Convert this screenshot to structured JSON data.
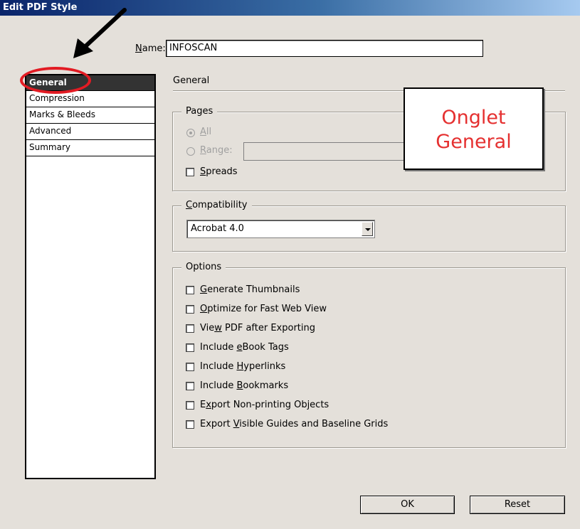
{
  "window": {
    "title": "Edit PDF Style"
  },
  "name_field": {
    "label_prefix": "",
    "label_accel": "N",
    "label_rest": "ame:",
    "value": "INFOSCAN"
  },
  "sidebar": {
    "items": [
      {
        "label": "General",
        "selected": true
      },
      {
        "label": "Compression",
        "selected": false
      },
      {
        "label": "Marks & Bleeds",
        "selected": false
      },
      {
        "label": "Advanced",
        "selected": false
      },
      {
        "label": "Summary",
        "selected": false
      }
    ]
  },
  "panel": {
    "heading": "General"
  },
  "pages": {
    "legend": "Pages",
    "all": {
      "accel": "A",
      "rest": "ll",
      "selected": true,
      "disabled": true
    },
    "range": {
      "accel": "R",
      "rest": "ange:",
      "disabled": true,
      "value": ""
    },
    "spreads": {
      "accel": "S",
      "rest": "preads",
      "checked": false
    }
  },
  "compatibility": {
    "legend_accel": "C",
    "legend_rest": "ompatibility",
    "selected": "Acrobat 4.0"
  },
  "options": {
    "legend": "Options",
    "items": [
      {
        "pre": "",
        "accel": "G",
        "post": "enerate Thumbnails",
        "checked": false
      },
      {
        "pre": "",
        "accel": "O",
        "post": "ptimize for Fast Web View",
        "checked": false
      },
      {
        "pre": "Vie",
        "accel": "w",
        "post": " PDF after Exporting",
        "checked": false
      },
      {
        "pre": "Include ",
        "accel": "e",
        "post": "Book Tags",
        "checked": false
      },
      {
        "pre": "Include ",
        "accel": "H",
        "post": "yperlinks",
        "checked": false
      },
      {
        "pre": "Include ",
        "accel": "B",
        "post": "ookmarks",
        "checked": false
      },
      {
        "pre": "E",
        "accel": "x",
        "post": "port Non-printing Objects",
        "checked": false
      },
      {
        "pre": "Export ",
        "accel": "V",
        "post": "isible Guides and Baseline Grids",
        "checked": false
      }
    ]
  },
  "buttons": {
    "ok": "OK",
    "reset": "Reset"
  },
  "annotation": {
    "callout_line1": "Onglet",
    "callout_line2": "General",
    "callout_color": "#e53030",
    "highlight_color": "#e21b23",
    "arrow_color": "#000000"
  }
}
